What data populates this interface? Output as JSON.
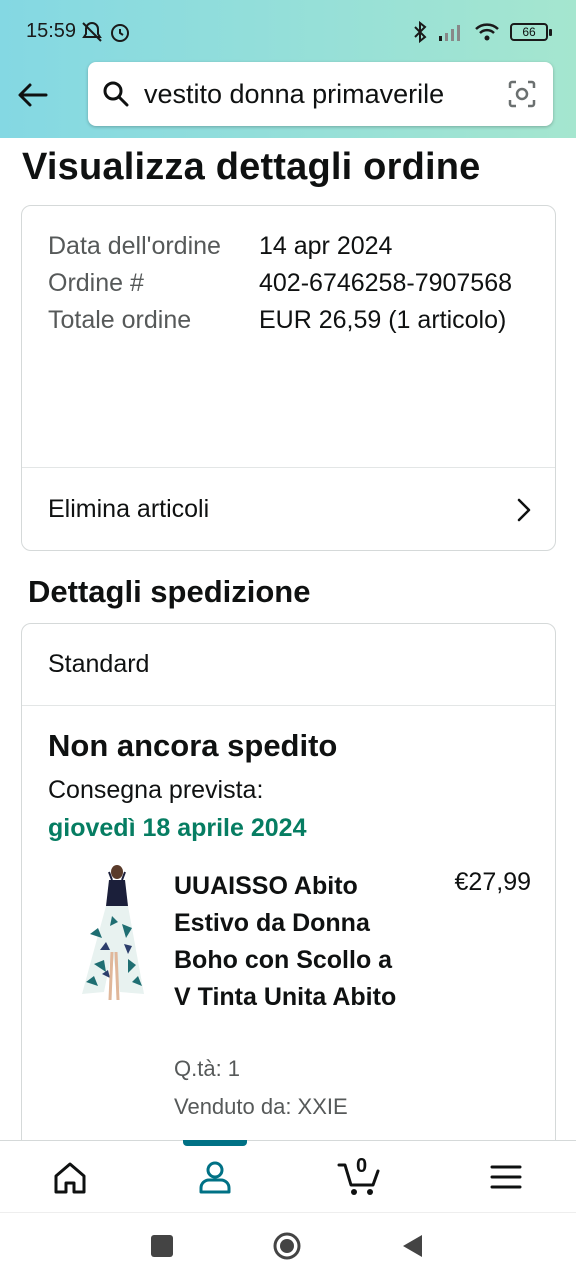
{
  "status_bar": {
    "time": "15:59",
    "battery": "66"
  },
  "search": {
    "query": "vestito donna primaverile"
  },
  "page": {
    "title": "Visualizza dettagli ordine"
  },
  "order": {
    "date_label": "Data dell'ordine",
    "date_value": "14 apr 2024",
    "number_label": "Ordine #",
    "number_value": "402-6746258-7907568",
    "total_label": "Totale ordine",
    "total_value": "EUR 26,59 (1 articolo)",
    "delete_items": "Elimina articoli"
  },
  "shipping": {
    "section_title": "Dettagli spedizione",
    "method": "Standard",
    "status": "Non ancora spedito",
    "delivery_label": "Consegna prevista:",
    "delivery_date": "giovedì 18 aprile 2024"
  },
  "product": {
    "title": "UUAISSO Abito Estivo da Donna Boho con Scollo a V Tinta Unita Abito",
    "price": "€27,99",
    "quantity": "Q.tà: 1",
    "seller": "Venduto da: XXIE"
  },
  "bottom_nav": {
    "items": [
      "home-icon",
      "account-icon",
      "cart-icon",
      "menu-icon"
    ],
    "active": "account-icon",
    "cart_count": "0"
  },
  "colors": {
    "accent": "#007185",
    "delivery_green": "#067d62",
    "header_gradient_start": "#84d8e3",
    "header_gradient_end": "#a5e6cf"
  }
}
